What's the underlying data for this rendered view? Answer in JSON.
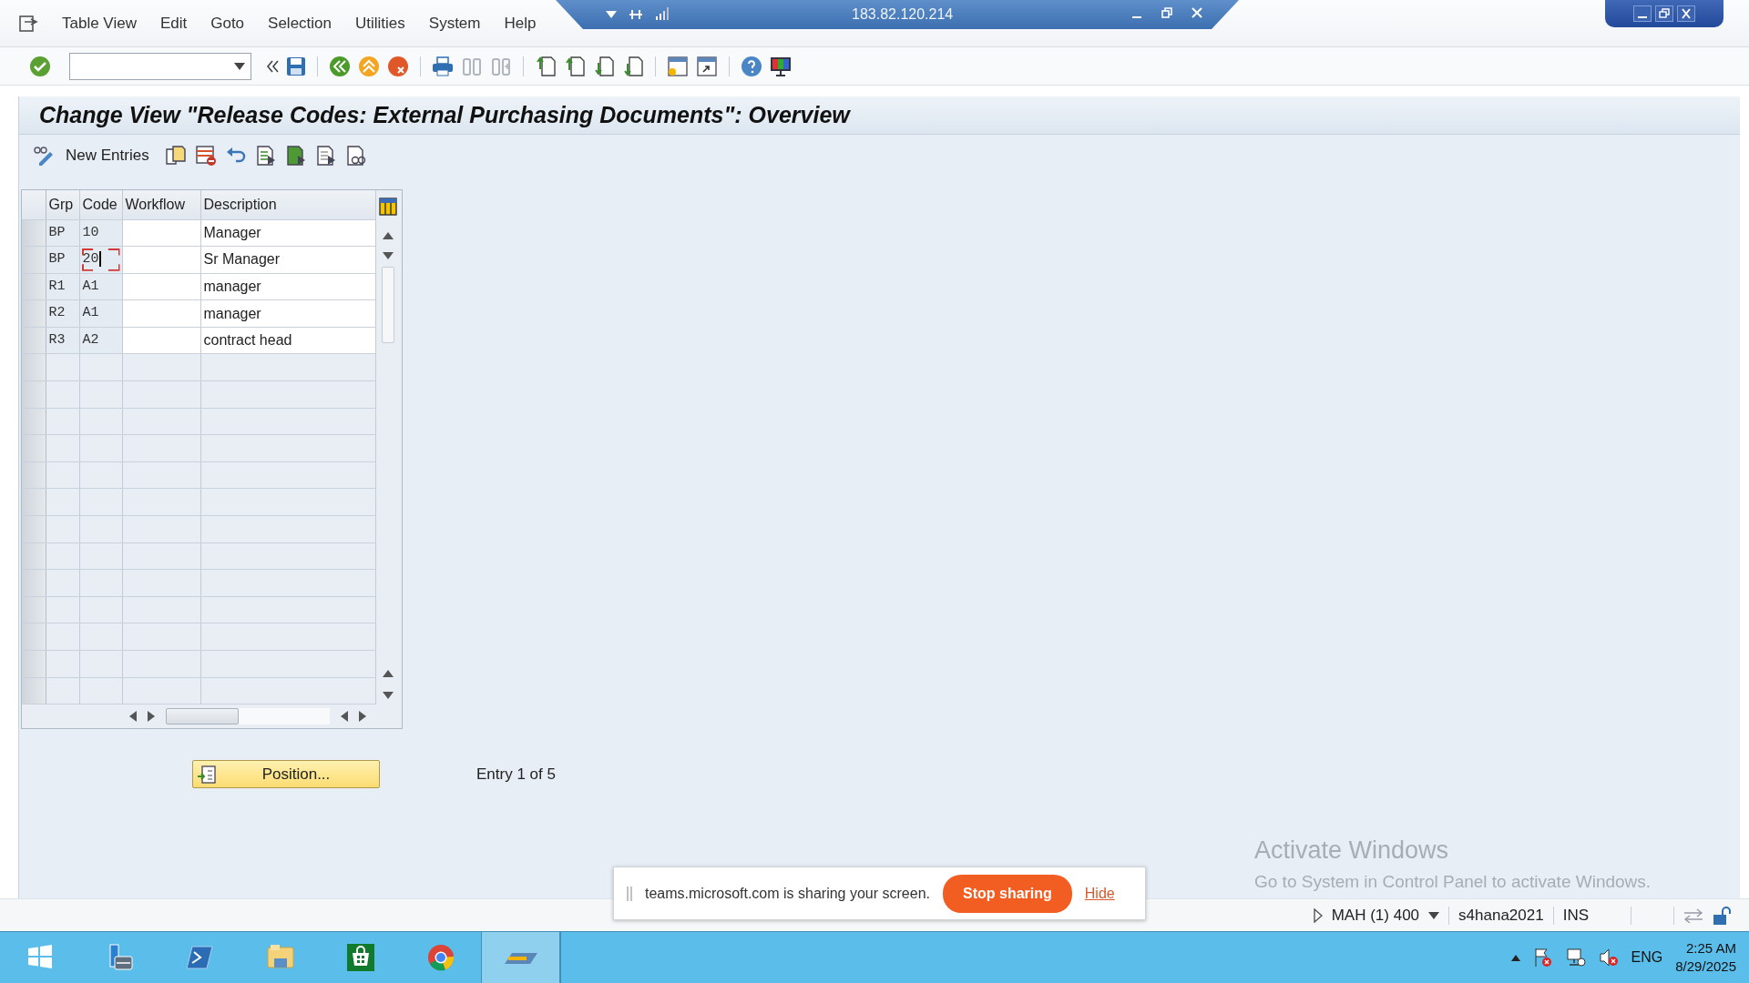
{
  "remote_bar": {
    "title": "183.82.120.214"
  },
  "menu": [
    "Table View",
    "Edit",
    "Goto",
    "Selection",
    "Utilities",
    "System",
    "Help"
  ],
  "title": "Change View \"Release Codes: External Purchasing Documents\": Overview",
  "app_toolbar": {
    "button": "New Entries"
  },
  "table": {
    "columns": [
      "Grp",
      "Code",
      "Workflow",
      "Description"
    ],
    "rows": [
      {
        "grp": "BP",
        "code": "10",
        "description": "Manager",
        "focused": false
      },
      {
        "grp": "BP",
        "code": "20",
        "description": "Sr Manager",
        "focused": true
      },
      {
        "grp": "R1",
        "code": "A1",
        "description": "manager",
        "focused": false
      },
      {
        "grp": "R2",
        "code": "A1",
        "description": "manager",
        "focused": false
      },
      {
        "grp": "R3",
        "code": "A2",
        "description": "contract head",
        "focused": false
      }
    ]
  },
  "position_button": "Position...",
  "entry_info": "Entry 1 of 5",
  "status_bar": {
    "system": "MAH (1) 400",
    "server": "s4hana2021",
    "mode": "INS"
  },
  "share_bar": {
    "message": "teams.microsoft.com is sharing your screen.",
    "stop_button": "Stop sharing",
    "hide_link": "Hide"
  },
  "activation_notice": {
    "title": "Activate Windows",
    "text": "Go to System in Control Panel to activate Windows."
  },
  "taskbar": {
    "items": [
      {
        "kind": "start",
        "selected": false
      },
      {
        "kind": "server",
        "selected": false
      },
      {
        "kind": "shell",
        "selected": false
      },
      {
        "kind": "folder",
        "selected": false
      },
      {
        "kind": "store",
        "selected": false
      },
      {
        "kind": "browser",
        "selected": false
      },
      {
        "kind": "sap",
        "selected": true
      }
    ],
    "language": "ENG",
    "time": "2:25 AM",
    "date": "8/29/2025"
  }
}
